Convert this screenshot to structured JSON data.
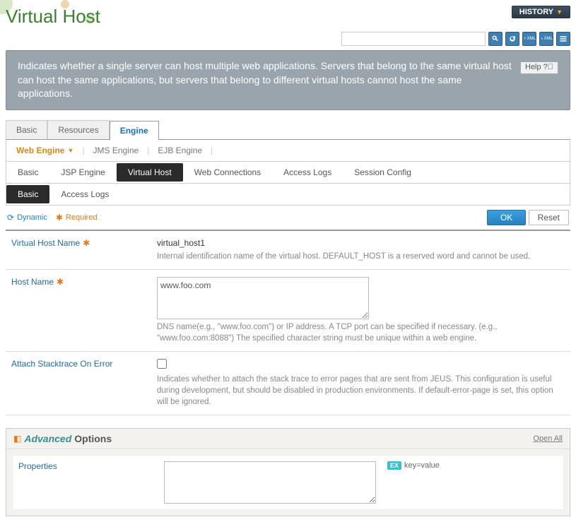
{
  "header": {
    "title": "Virtual Host",
    "history_label": "HISTORY"
  },
  "search": {
    "value": "",
    "placeholder": ""
  },
  "description": "Indicates whether a single server can host multiple web applications. Servers that belong to the same virtual host can host the same applications, but servers that belong to different virtual hosts cannot host the same applications.",
  "help_label": "Help",
  "tabs": {
    "items": [
      "Basic",
      "Resources",
      "Engine"
    ],
    "active_index": 2
  },
  "engine_tabs": {
    "items": [
      "Web Engine",
      "JMS Engine",
      "EJB Engine"
    ],
    "active_index": 0
  },
  "sub_tabs": {
    "items": [
      "Basic",
      "JSP Engine",
      "Virtual Host",
      "Web Connections",
      "Access Logs",
      "Session Config"
    ],
    "active_index": 2
  },
  "subsub_tabs": {
    "items": [
      "Basic",
      "Access Logs"
    ],
    "active_index": 0
  },
  "legend": {
    "dynamic": "Dynamic",
    "required": "Required"
  },
  "buttons": {
    "ok": "OK",
    "reset": "Reset"
  },
  "form": {
    "virtual_host_name": {
      "label": "Virtual Host Name",
      "required": true,
      "value": "virtual_host1",
      "help": "Internal identification name of the virtual host. DEFAULT_HOST is a reserved word and cannot be used."
    },
    "host_name": {
      "label": "Host Name",
      "required": true,
      "value": "www.foo.com",
      "help": "DNS name(e.g., \"www.foo.com\") or IP address. A TCP port can be specified if necessary. (e.g., \"www.foo.com:8088\") The specified character string must be unique within a web engine."
    },
    "attach_stacktrace": {
      "label": "Attach Stacktrace On Error",
      "checked": false,
      "help": "Indicates whether to attach the stack trace to error pages that are sent from JEUS. This configuration is useful during development, but should be disabled in production environments. If default-error-page is set, this option will be ignored."
    }
  },
  "advanced": {
    "title_advanced": "Advanced",
    "title_options": "Options",
    "open_all": "Open All",
    "properties": {
      "label": "Properties",
      "value": "",
      "hint_badge": "EX",
      "hint_text": "key=value"
    }
  }
}
